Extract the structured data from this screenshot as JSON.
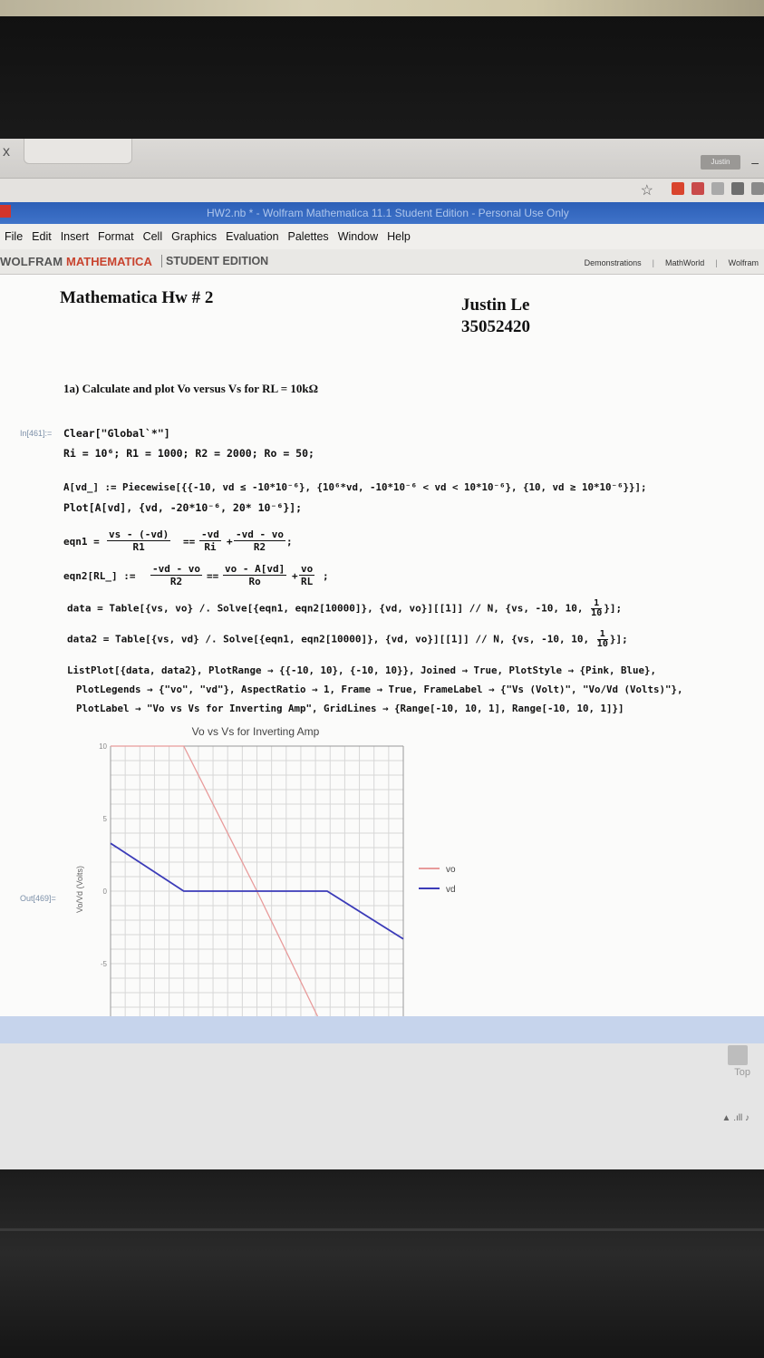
{
  "browser": {
    "tab_close": "x",
    "profile": "Justin",
    "minimize": "–"
  },
  "window": {
    "title": "HW2.nb * - Wolfram Mathematica 11.1 Student Edition - Personal Use Only"
  },
  "menu": [
    "File",
    "Edit",
    "Insert",
    "Format",
    "Cell",
    "Graphics",
    "Evaluation",
    "Palettes",
    "Window",
    "Help"
  ],
  "brand": {
    "wolfram": "WOLFRAM",
    "mathematica": "MATHEMATICA",
    "edition": "STUDENT EDITION",
    "links": [
      "Demonstrations",
      "MathWorld",
      "Wolfram"
    ],
    "separator": "|"
  },
  "notebook": {
    "title": "Mathematica Hw # 2",
    "author_name": "Justin Le",
    "author_id": "35052420",
    "section": "1a) Calculate and plot Vo versus Vs for RL = 10kΩ",
    "in_label": "In[461]:=",
    "out_label": "Out[469]=",
    "code": {
      "line1": "Clear[\"Global`*\"]",
      "line2": "Ri = 10⁶; R1 = 1000; R2 = 2000; Ro = 50;",
      "line3": "A[vd_] := Piecewise[{{-10, vd ≤ -10*10⁻⁶}, {10⁶*vd, -10*10⁻⁶ < vd < 10*10⁻⁶}, {10, vd ≥ 10*10⁻⁶}}];",
      "line4": "Plot[A[vd], {vd, -20*10⁻⁶, 20* 10⁻⁶}];",
      "eqn1_lhs": "eqn1 =",
      "eqn1_n1": "vs - (-vd)",
      "eqn1_d1": "R1",
      "eqn1_eq": "==",
      "eqn1_n2": "-vd",
      "eqn1_d2": "Ri",
      "eqn1_plus": "+",
      "eqn1_n3": "-vd - vo",
      "eqn1_d3": "R2",
      "eqn1_end": ";",
      "eqn2_lhs": "eqn2[RL_] :=",
      "eqn2_n1": "-vd - vo",
      "eqn2_d1": "R2",
      "eqn2_eq": "==",
      "eqn2_n2": "vo - A[vd]",
      "eqn2_d2": "Ro",
      "eqn2_plus": "+",
      "eqn2_n3": "vo",
      "eqn2_d3": "RL",
      "eqn2_end": ";",
      "data1_a": "data = Table[{vs, vo} /. Solve[{eqn1, eqn2[10000]}, {vd, vo}][[1]] // N, {vs, -10, 10,",
      "data2_a": "data2 = Table[{vs, vd} /. Solve[{eqn1, eqn2[10000]}, {vd, vo}][[1]] // N, {vs, -10, 10,",
      "frac_num": "1",
      "frac_den": "10",
      "data_end": "}];",
      "lp1": "ListPlot[{data, data2}, PlotRange → {{-10, 10}, {-10, 10}}, Joined → True, PlotStyle → {Pink, Blue},",
      "lp2": "PlotLegends → {\"vo\", \"vd\"}, AspectRatio → 1, Frame → True, FrameLabel → {\"Vs (Volt)\", \"Vo/Vd (Volts)\"},",
      "lp3": "PlotLabel → \"Vo vs Vs for Inverting Amp\", GridLines → {Range[-10, 10, 1], Range[-10, 10, 1]}]"
    }
  },
  "chart_data": {
    "type": "line",
    "title": "Vo vs Vs for Inverting Amp",
    "ylabel": "Vo/Vd (Volts)",
    "xlim": [
      -10,
      10
    ],
    "ylim": [
      -10,
      10
    ],
    "yticks": [
      10,
      5,
      0,
      -5
    ],
    "grid": true,
    "legend_position": "right",
    "series": [
      {
        "name": "vo",
        "color": "#e89b9b",
        "x": [
          -10,
          -5,
          0,
          4.8
        ],
        "y": [
          10,
          10,
          0,
          -10
        ]
      },
      {
        "name": "vd",
        "color": "#3b3bb8",
        "x": [
          -10,
          -5,
          4.8,
          10
        ],
        "y": [
          3.3,
          0,
          0,
          -3.3
        ]
      }
    ]
  },
  "footer": {
    "top_label": "Top",
    "tray": "▲ .ıll ♪"
  }
}
